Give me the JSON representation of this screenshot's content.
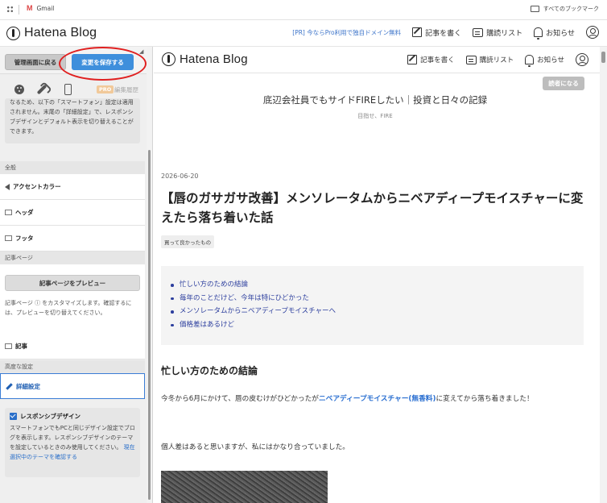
{
  "browser": {
    "bookmark_gmail": "Gmail",
    "bookmark_all": "すべてのブックマーク"
  },
  "header": {
    "logo": "Hatena Blog",
    "promo": "[PR] 今ならPro利用で独自ドメイン無料",
    "write": "記事を書く",
    "subscribe": "購読リスト",
    "notify": "お知らせ"
  },
  "editor": {
    "back_button": "管理画面に戻る",
    "save_button": "変更を保存する",
    "pro_badge": "PRO",
    "history": "編集履歴",
    "font_note": "なるため、以下の「スマートフォン」設定は適用されません。末尾の「詳細設定」で、レスポンシブデザインとデフォルト表示を切り替えることができます。",
    "section_general": "全般",
    "accent_color": "アクセントカラー",
    "header_item": "ヘッダ",
    "footer_item": "フッタ",
    "section_article": "記事ページ",
    "preview_button": "記事ページをプレビュー",
    "preview_note": "記事ページ ⓘ をカスタマイズします。確認するには、プレビューを切り替えてください。",
    "article_item": "記事",
    "section_advanced": "高度な設定",
    "detail_item": "詳細設定",
    "responsive_title": "レスポンシブデザイン",
    "responsive_desc": "スマートフォンでもPCと同じデザイン設定でブログを表示します。レスポンシブデザインのテーマを設定しているときのみ使用してください。",
    "responsive_link": "現在選択中のテーマを確認する"
  },
  "preview": {
    "logo": "Hatena Blog",
    "write": "記事を書く",
    "subscribe": "購読リスト",
    "notify": "お知らせ",
    "reader_button": "読者になる",
    "blog_title": "底辺会社員でもサイドFIREしたい｜投資と日々の記録",
    "blog_subtitle": "目指せ、FIRE",
    "date": "2026-06-20",
    "article_title": "【唇のガサガサ改善】メンソレータムからニベアディープモイスチャーに変えたら落ち着いた話",
    "tag": "買って良かったもの",
    "toc": [
      "忙しい方のための結論",
      "毎年のことだけど、今年は特にひどかった",
      "メンソレータムからニベアディープモイスチャーへ",
      "価格差はあるけど"
    ],
    "heading": "忙しい方のための結論",
    "para1_a": "今冬から6月にかけて、唇の皮むけがひどかったが",
    "para1_link": "ニベアディープモイスチャー(無香料)",
    "para1_b": "に変えてから落ち着きました！",
    "para2": "個人差はあると思いますが、私にはかなり合っていました。"
  }
}
